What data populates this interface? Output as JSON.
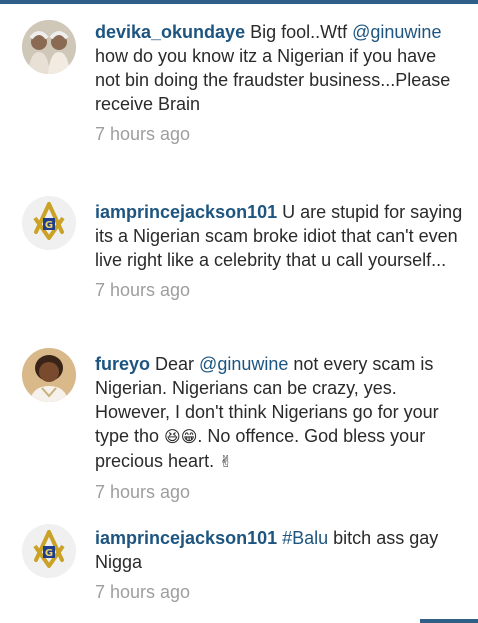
{
  "comments": [
    {
      "username": "devika_okundaye",
      "t1": " Big fool..Wtf ",
      "mention": "@ginuwine",
      "t2": " how do you know itz a Nigerian if you have not bin doing the fraudster business...Please receive Brain",
      "time": "7 hours ago"
    },
    {
      "username": "iamprincejackson101",
      "t1": " U are stupid for saying its a Nigerian scam broke idiot that can't even live right like a celebrity that u call yourself...",
      "time": "7 hours ago"
    },
    {
      "username": "fureyo",
      "t1": " Dear ",
      "mention": "@ginuwine",
      "t2": " not every scam is Nigerian. Nigerians can be crazy, yes. However, I don't think Nigerians go for your type tho ",
      "emoji1": "😆😁",
      "t3": ". No offence. God bless your precious heart. ",
      "emoji2": "✌",
      "time": "7 hours ago"
    },
    {
      "username": "iamprincejackson101",
      "t1": " ",
      "hashtag": "#Balu",
      "t2": " bitch ass gay Nigga",
      "time": "7 hours ago"
    }
  ],
  "colors": {
    "username": "#1d5580",
    "timestamp": "#9e9e9e",
    "text": "#2a2a2a",
    "accent_bar": "#2f5f86"
  }
}
